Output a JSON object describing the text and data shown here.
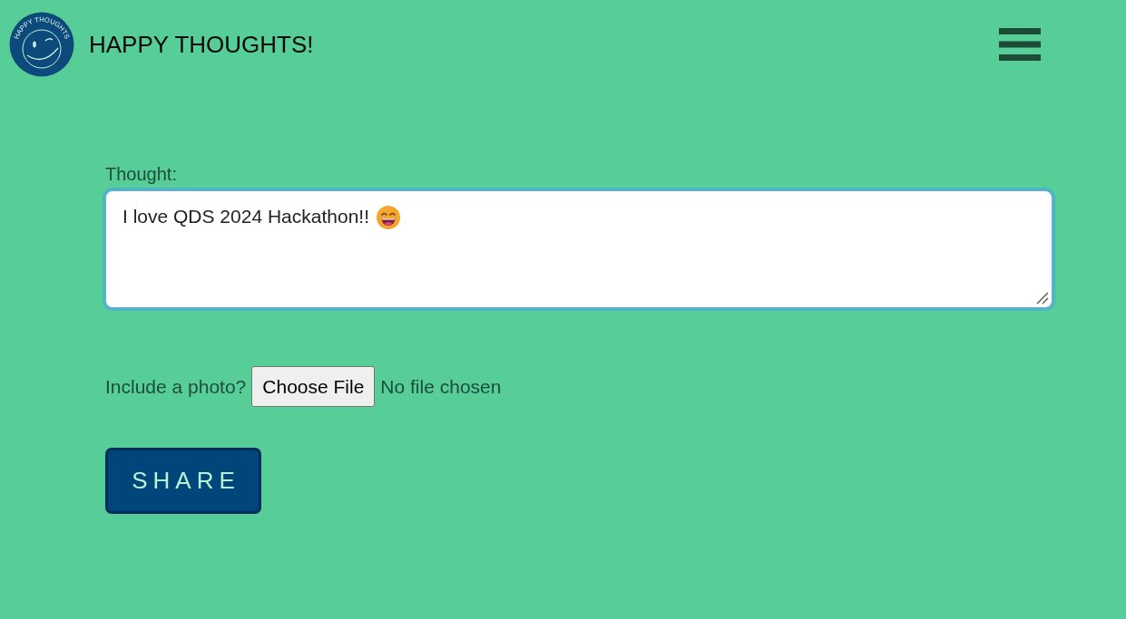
{
  "header": {
    "logo": {
      "text": "HAPPY THOUGHTS"
    },
    "title": "HAPPY THOUGHTS!"
  },
  "form": {
    "thought": {
      "label": "Thought:",
      "value": "I love QDS 2024 Hackathon!!",
      "focused": true
    },
    "photo": {
      "label": "Include a photo?",
      "button": "Choose File",
      "status": "No file chosen"
    },
    "submit": "SHARE"
  }
}
